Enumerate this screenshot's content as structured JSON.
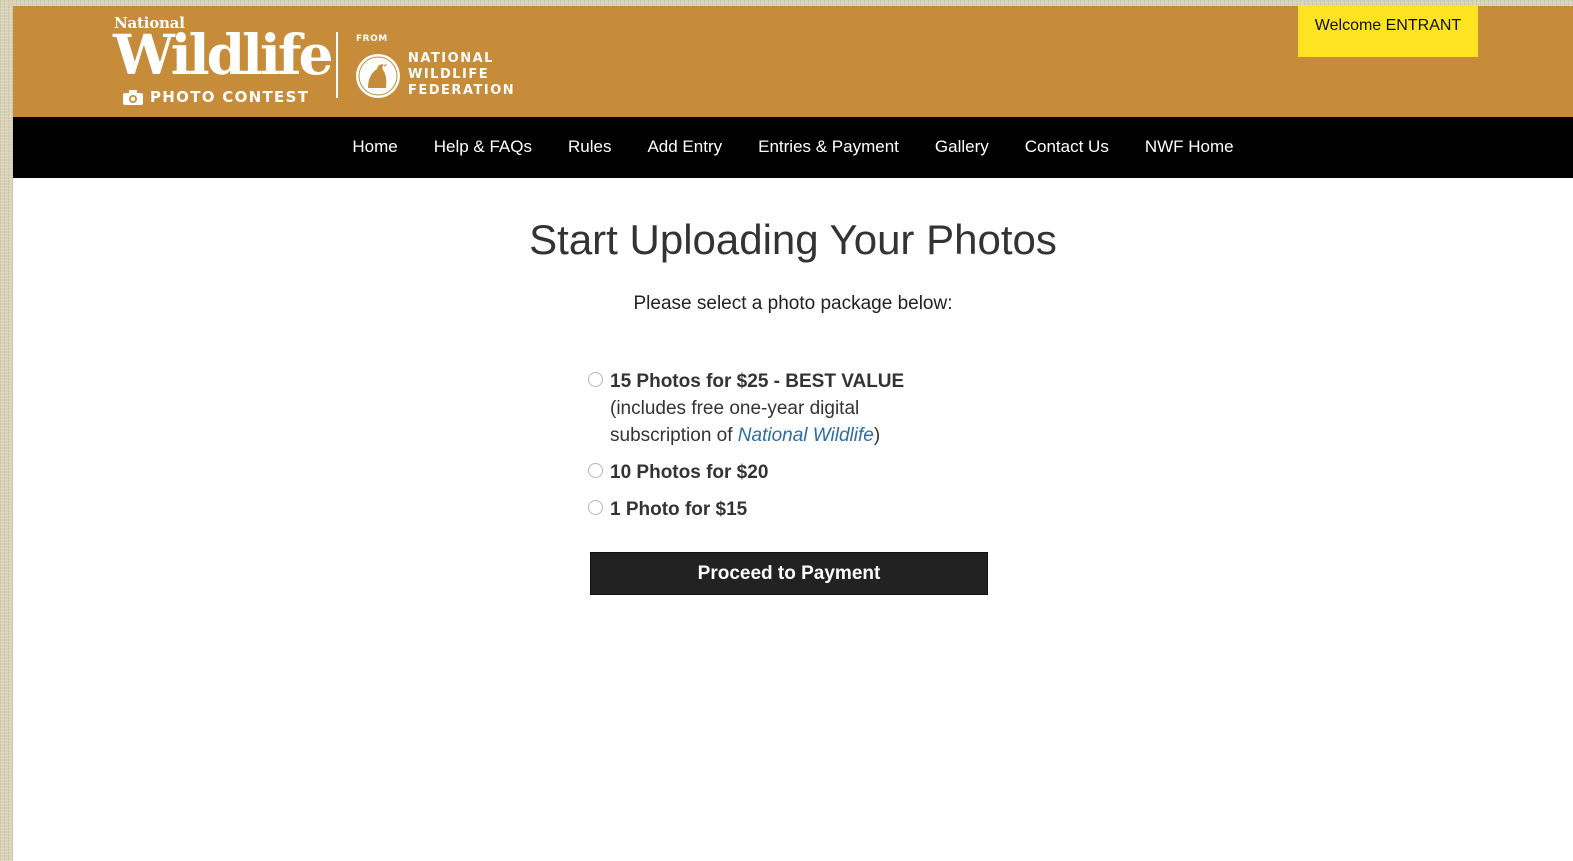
{
  "header": {
    "logo": {
      "line1": "National",
      "line2": "Wildlife",
      "line3": "PHOTO CONTEST"
    },
    "partner": {
      "from": "FROM",
      "name": "NATIONAL WILDLIFE FEDERATION"
    },
    "welcome": "Welcome ENTRANT",
    "colors": {
      "bar": "#c68c3a",
      "welcome_bg": "#fde322"
    }
  },
  "nav": {
    "items": [
      "Home",
      "Help & FAQs",
      "Rules",
      "Add Entry",
      "Entries & Payment",
      "Gallery",
      "Contact Us",
      "NWF Home"
    ]
  },
  "main": {
    "title": "Start Uploading Your Photos",
    "subtitle": "Please select a photo package below:",
    "packages": [
      {
        "label": "15 Photos for $25 - BEST VALUE",
        "note_before": "(includes free one-year digital subscription of ",
        "note_link": "National Wildlife",
        "note_after": ")"
      },
      {
        "label": "10 Photos for $20"
      },
      {
        "label": "1 Photo for $15"
      }
    ],
    "proceed_label": "Proceed to Payment"
  }
}
